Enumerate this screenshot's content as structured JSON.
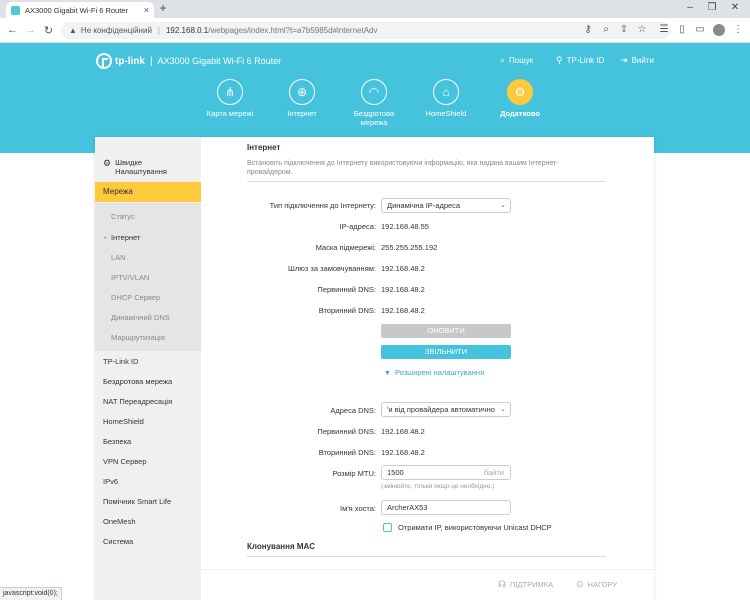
{
  "browser": {
    "tab_title": "AX3000 Gigabit Wi-Fi 6 Router",
    "tab_close": "×",
    "new_tab": "+",
    "not_secure": "Не конфіденційний",
    "url_host": "192.168.0.1",
    "url_path": "/webpages/index.html?t=a7b5985d#internetAdv",
    "status_text": "javascript:void(0);"
  },
  "header": {
    "brand": "tp-link",
    "model": "AX3000 Gigabit Wi-Fi 6 Router",
    "search": "Пошук",
    "tplink_id": "TP-Link ID",
    "logout": "Вийти"
  },
  "topnav": [
    {
      "label": "Карта мережі",
      "icon": "network-map-icon"
    },
    {
      "label": "Інтернет",
      "icon": "globe-icon"
    },
    {
      "label": "Бездротова мережа",
      "icon": "wifi-icon"
    },
    {
      "label": "HomeShield",
      "icon": "homeshield-icon"
    },
    {
      "label": "Додатково",
      "icon": "gear-icon",
      "active": true
    }
  ],
  "sidebar": {
    "quick_setup": "Швидке Налаштування",
    "active_section": "Мережа",
    "sub_items": [
      "Статус",
      "Інтернет",
      "LAN",
      "IPTV/VLAN",
      "DHCP Сервер",
      "Динамічний DNS",
      "Маршрутизація"
    ],
    "current_sub": "Інтернет",
    "items": [
      "TP-Link ID",
      "Бездротова мережа",
      "NAT Переадресація",
      "HomeShield",
      "Безпека",
      "VPN Сервер",
      "IPv6",
      "Помічник Smart Life",
      "OneMesh",
      "Система"
    ]
  },
  "internet": {
    "title": "Інтернет",
    "description": "Встановіть підключення до Інтернету використовуючи інформацію, яка надана вашим Інтернет-провайдером.",
    "conn_type_label": "Тип підключення до Інтернету:",
    "conn_type_value": "Динамічна IP-адреса",
    "ip_label": "IP-адреса:",
    "ip_value": "192.168.48.55",
    "mask_label": "Маска підмережі:",
    "mask_value": "255.255.255.192",
    "gateway_label": "Шлюз за замовчуванням:",
    "gateway_value": "192.168.48.2",
    "dns1_label": "Первинний DNS:",
    "dns1_value": "192.168.48.2",
    "dns2_label": "Вторинний DNS:",
    "dns2_value": "192.168.48.2",
    "renew_button": "ОНОВИТИ",
    "release_button": "ЗВІЛЬНИТИ",
    "advanced": "Розширені налаштування"
  },
  "advanced": {
    "dns_addr_label": "Адреса DNS:",
    "dns_addr_value": "'и від провайдера автоматично",
    "dns1_label": "Первинний DNS:",
    "dns1_value": "192.168.48.2",
    "dns2_label": "Вторинний DNS:",
    "dns2_value": "192.168.48.2",
    "mtu_label": "Розмір MTU:",
    "mtu_value": "1500",
    "mtu_unit": "байти",
    "mtu_hint": "(змінюйте, тільки якщо це необхідно.)",
    "hostname_label": "Ім'я хоста:",
    "hostname_value": "ArcherAX53",
    "unicast_label": "Отримати IP, використовуючи Unicast DHCP"
  },
  "mac_clone": {
    "title": "Клонування MAC"
  },
  "footer": {
    "support": "ПІДТРИМКА",
    "back_to_top": "НАГОРУ"
  },
  "colors": {
    "accent": "#45c3dc",
    "active": "#fcca3c"
  }
}
